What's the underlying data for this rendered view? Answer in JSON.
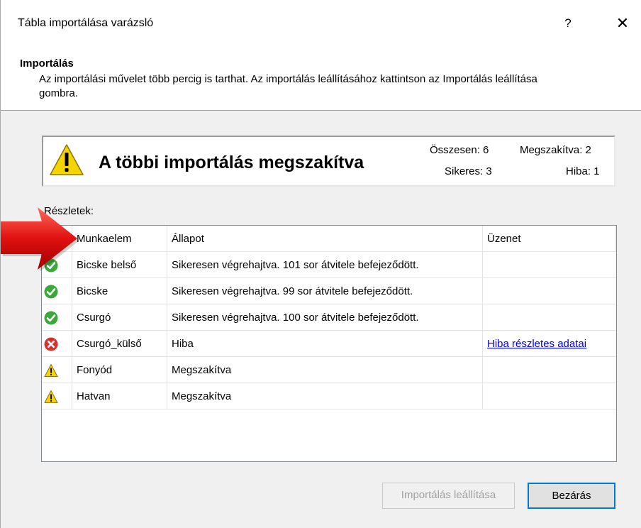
{
  "window": {
    "title": "Tábla importálása varázsló",
    "help": "?",
    "close": "✕"
  },
  "header": {
    "title": "Importálás",
    "description": "Az importálási művelet több percig is tarthat. Az importálás leállításához kattintson az Importálás leállítása gombra."
  },
  "summary": {
    "title": "A többi importálás megszakítva",
    "total": "Összesen: 6",
    "aborted": "Megszakítva: 2",
    "success": "Sikeres: 3",
    "error": "Hiba: 1"
  },
  "details": {
    "label": "Részletek:",
    "columns": [
      "",
      "Munkaelem",
      "Állapot",
      "Üzenet"
    ],
    "rows": [
      {
        "icon": "success-icon",
        "item": "Bicske belső",
        "status": "Sikeresen végrehajtva. 101 sor átvitele befejeződött.",
        "message": ""
      },
      {
        "icon": "success-icon",
        "item": "Bicske",
        "status": "Sikeresen végrehajtva. 99 sor átvitele befejeződött.",
        "message": ""
      },
      {
        "icon": "success-icon",
        "item": "Csurgó",
        "status": "Sikeresen végrehajtva. 100 sor átvitele befejeződött.",
        "message": ""
      },
      {
        "icon": "error-icon",
        "item": "Csurgó_külső",
        "status": "Hiba",
        "message": "Hiba részletes adatai"
      },
      {
        "icon": "warning-icon",
        "item": "Fonyód",
        "status": "Megszakítva",
        "message": ""
      },
      {
        "icon": "warning-icon",
        "item": "Hatvan",
        "status": "Megszakítva",
        "message": ""
      }
    ]
  },
  "buttons": {
    "stop": "Importálás leállítása",
    "close": "Bezárás"
  },
  "colors": {
    "success": "#3aa83a",
    "error": "#d9332b",
    "warning": "#f5d400",
    "accent": "#0078d7",
    "arrow": "#e01010"
  }
}
